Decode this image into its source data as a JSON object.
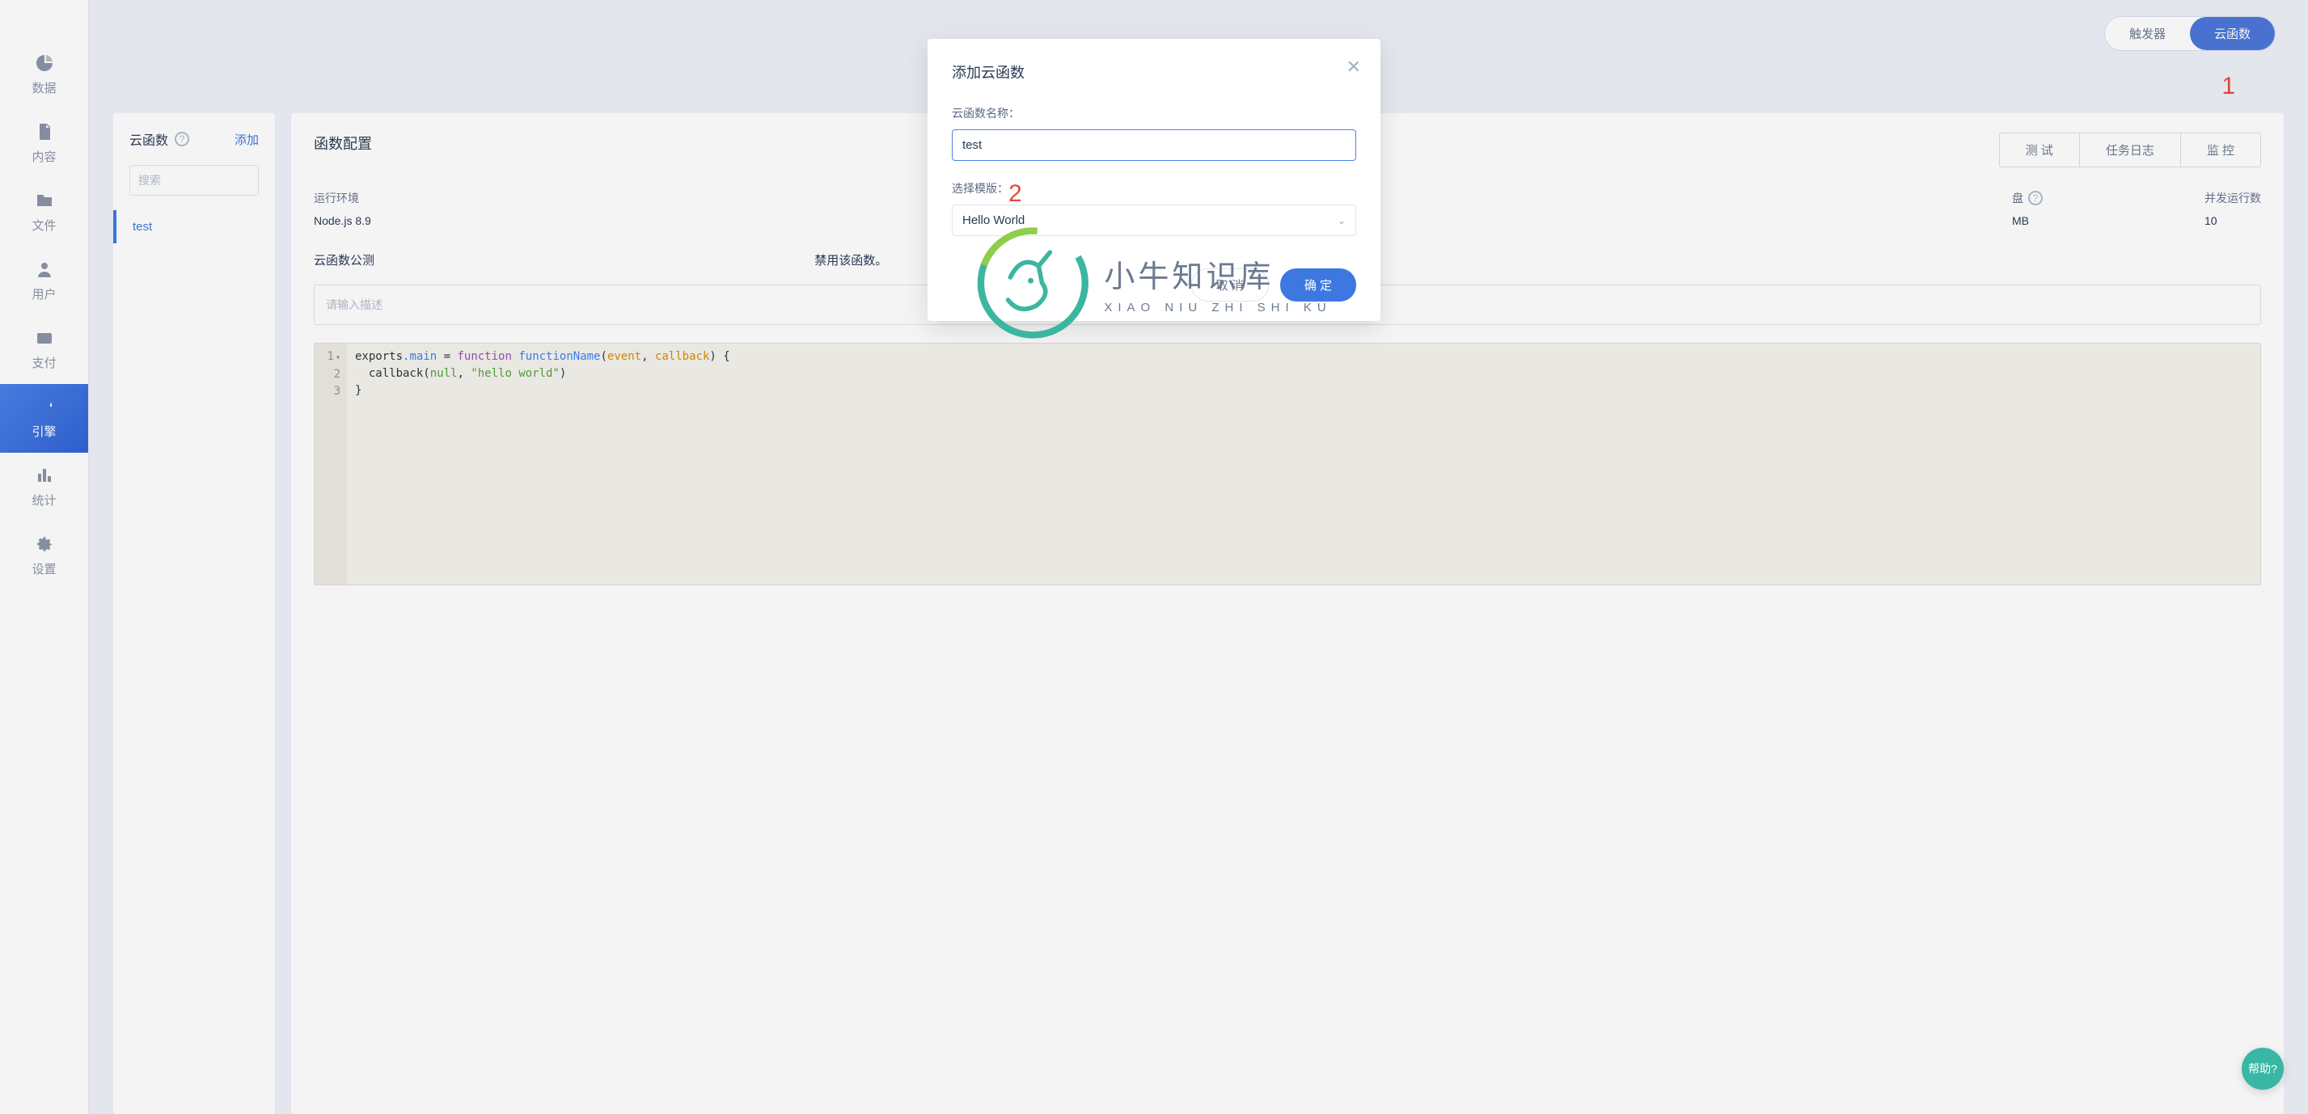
{
  "sidebar": {
    "items": [
      {
        "label": "数据",
        "icon": "pie-chart-icon",
        "active": false
      },
      {
        "label": "内容",
        "icon": "file-icon",
        "active": false
      },
      {
        "label": "文件",
        "icon": "folder-icon",
        "active": false
      },
      {
        "label": "用户",
        "icon": "user-icon",
        "active": false
      },
      {
        "label": "支付",
        "icon": "wallet-icon",
        "active": false
      },
      {
        "label": "引擎",
        "icon": "engine-icon",
        "active": true
      },
      {
        "label": "统计",
        "icon": "chart-bar-icon",
        "active": false
      },
      {
        "label": "设置",
        "icon": "gear-icon",
        "active": false
      }
    ]
  },
  "top_tabs": {
    "triggers": "触发器",
    "cloud_functions": "云函数"
  },
  "annotations": {
    "one": "1",
    "two": "2"
  },
  "side_panel": {
    "title": "云函数",
    "add": "添加",
    "search_placeholder": "搜索",
    "items": [
      "test"
    ]
  },
  "content": {
    "title": "函数配置",
    "actions": {
      "test": "测 试",
      "logs": "任务日志",
      "monitor": "监 控"
    },
    "config": {
      "runtime_label": "运行环境",
      "runtime_value": "Node.js 8.9",
      "disk_label_suffix": "盘",
      "disk_value_suffix": "MB",
      "concurrency_label": "并发运行数",
      "concurrency_value": "10"
    },
    "notice_prefix": "云函数公测",
    "notice_suffix": "禁用该函数。",
    "description_placeholder": "请输入描述",
    "code": {
      "lines": [
        "1",
        "2",
        "3"
      ],
      "line1_html": "exports.main = function functionName(event, callback) {",
      "line2_html": "  callback(null, \"hello world\")",
      "line3_html": "}"
    }
  },
  "modal": {
    "title": "添加云函数",
    "name_label": "云函数名称：",
    "name_value": "test",
    "template_label": "选择模版：",
    "template_value": "Hello World",
    "cancel": "取 消",
    "ok": "确 定"
  },
  "watermark": {
    "cn": "小牛知识库",
    "en": "XIAO NIU ZHI SHI KU"
  },
  "help": "帮助?"
}
